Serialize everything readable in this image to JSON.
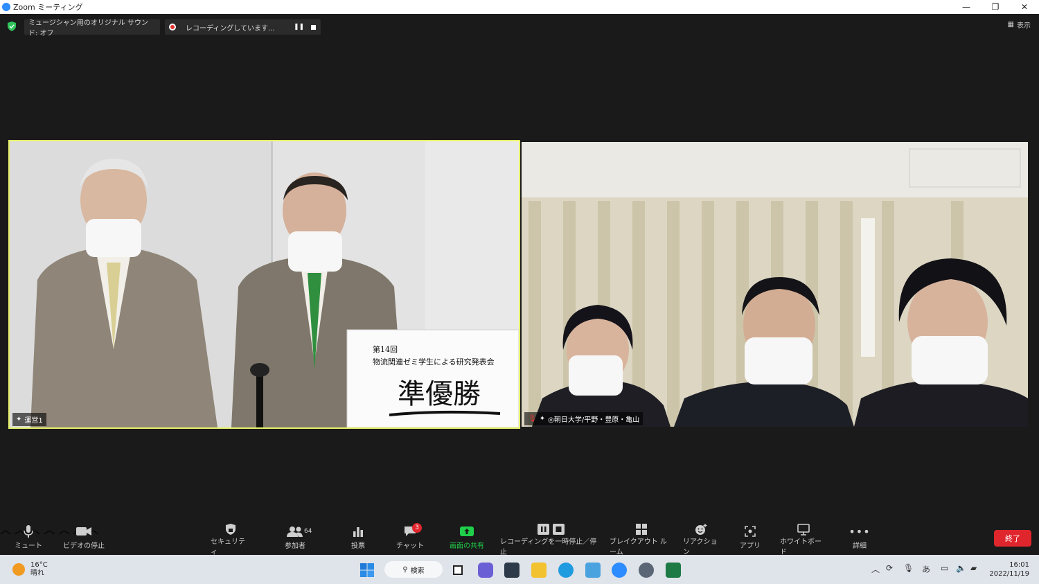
{
  "window": {
    "title": "Zoom ミーティング",
    "controls": [
      "—",
      "❐",
      "✕"
    ]
  },
  "top_bar": {
    "audio_status": "ミュージシャン用のオリジナル サウンド: オフ",
    "recording_status": "レコーディングしています...",
    "view_label": "表示"
  },
  "video_tiles": [
    {
      "name": "運営1",
      "sign": {
        "line1": "第14回",
        "line2": "物流関連ゼミ学生による研究発表会",
        "big": "準優勝"
      }
    },
    {
      "name": "◎朝日大学/平野・豊原・亀山"
    }
  ],
  "toolbar": {
    "mute": "ミュート",
    "video": "ビデオの停止",
    "security": "セキュリティ",
    "participants": "参加者",
    "participants_count": "64",
    "poll": "投票",
    "chat": "チャット",
    "chat_badge": "3",
    "share": "画面の共有",
    "recording": "レコーディングを一時停止／停止",
    "breakout": "ブレイクアウト ルーム",
    "reactions": "リアクション",
    "apps": "アプリ",
    "whiteboard": "ホワイトボード",
    "more": "詳細",
    "end": "終了",
    "accent_share": "#1fd04a",
    "end_color": "#e0262d"
  },
  "taskbar": {
    "temperature": "16°C",
    "weather": "晴れ",
    "search": "検索",
    "ime": "あ",
    "time": "16:01",
    "date": "2022/11/19"
  }
}
